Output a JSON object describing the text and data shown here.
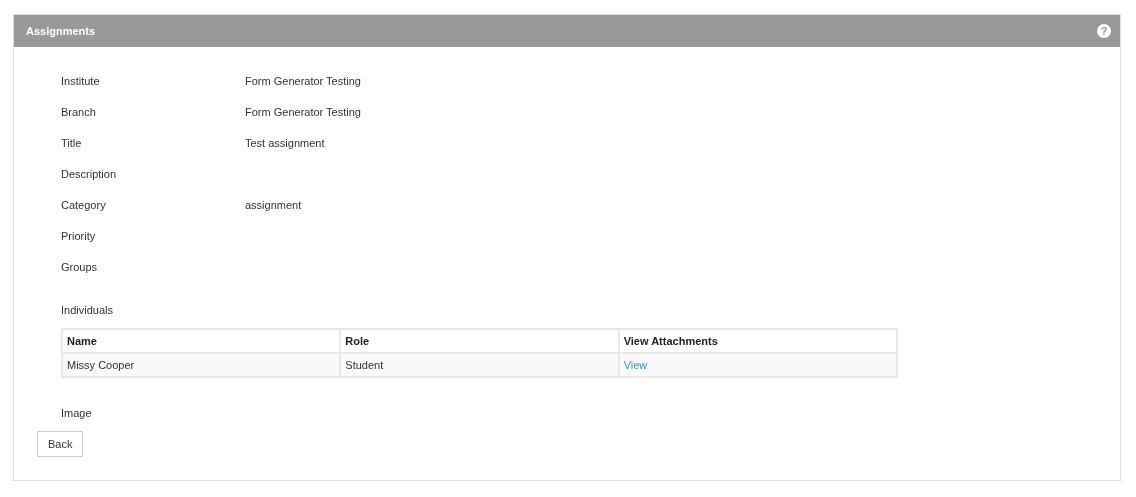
{
  "panel": {
    "title": "Assignments",
    "help_icon": "?"
  },
  "fields": [
    {
      "label": "Institute",
      "value": "Form Generator Testing"
    },
    {
      "label": "Branch",
      "value": "Form Generator Testing"
    },
    {
      "label": "Title",
      "value": "Test assignment"
    },
    {
      "label": "Description"
    },
    {
      "label": "Category",
      "value": "assignment"
    },
    {
      "label": "Priority"
    },
    {
      "label": "Groups"
    }
  ],
  "individuals": {
    "label": "Individuals",
    "columns": [
      "Name",
      "Role",
      "View Attachments"
    ],
    "rows": [
      [
        {
          "kind": "text",
          "text": "Missy Cooper"
        },
        {
          "kind": "text",
          "text": "Student"
        },
        {
          "kind": "link",
          "text": "View"
        }
      ]
    ]
  },
  "image_label": "Image",
  "buttons": [
    "Back"
  ]
}
